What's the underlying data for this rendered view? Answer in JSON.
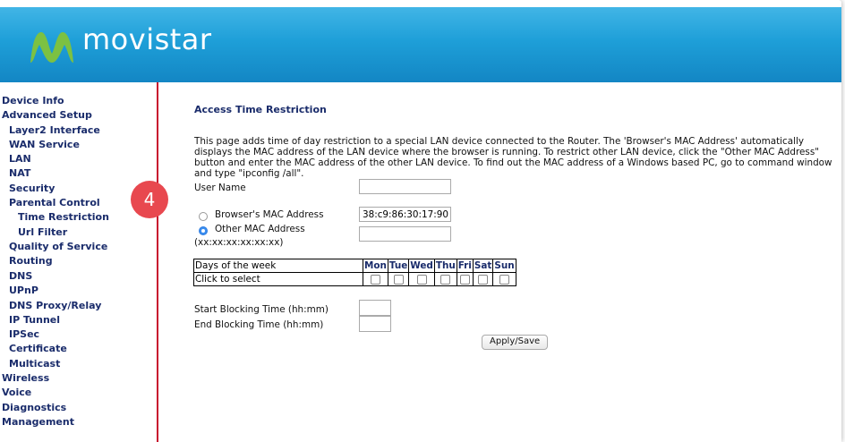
{
  "brand": {
    "name": "movistar"
  },
  "sidebar": {
    "items": [
      {
        "label": "Device Info",
        "level": 1
      },
      {
        "label": "Advanced Setup",
        "level": 1
      },
      {
        "label": "Layer2 Interface",
        "level": 2
      },
      {
        "label": "WAN Service",
        "level": 2
      },
      {
        "label": "LAN",
        "level": 2
      },
      {
        "label": "NAT",
        "level": 2
      },
      {
        "label": "Security",
        "level": 2
      },
      {
        "label": "Parental Control",
        "level": 2
      },
      {
        "label": "Time Restriction",
        "level": 3
      },
      {
        "label": "Url Filter",
        "level": 3
      },
      {
        "label": "Quality of Service",
        "level": 2
      },
      {
        "label": "Routing",
        "level": 2
      },
      {
        "label": "DNS",
        "level": 2
      },
      {
        "label": "UPnP",
        "level": 2
      },
      {
        "label": "DNS Proxy/Relay",
        "level": 2
      },
      {
        "label": "IP Tunnel",
        "level": 2
      },
      {
        "label": "IPSec",
        "level": 2
      },
      {
        "label": "Certificate",
        "level": 2
      },
      {
        "label": "Multicast",
        "level": 2
      },
      {
        "label": "Wireless",
        "level": 1
      },
      {
        "label": "Voice",
        "level": 1
      },
      {
        "label": "Diagnostics",
        "level": 1
      },
      {
        "label": "Management",
        "level": 1
      }
    ]
  },
  "badge": {
    "text": "4"
  },
  "main": {
    "title": "Access Time Restriction",
    "description": "This page adds time of day restriction to a special LAN device connected to the Router. The 'Browser's MAC Address' automatically displays the MAC address of the LAN device where the browser is running. To restrict other LAN device, click the \"Other MAC Address\" button and enter the MAC address of the other LAN device. To find out the MAC address of a Windows based PC, go to command window and type \"ipconfig /all\".",
    "user_name_label": "User Name",
    "user_name_value": "",
    "browser_mac_label": "Browser's MAC Address",
    "browser_mac_value": "38:c9:86:30:17:90",
    "browser_mac_selected": false,
    "other_mac_label": "Other MAC Address",
    "other_mac_format": "(xx:xx:xx:xx:xx:xx)",
    "other_mac_value": "",
    "other_mac_selected": true,
    "days_header_label": "Days of the week",
    "days_select_label": "Click to select",
    "days": [
      "Mon",
      "Tue",
      "Wed",
      "Thu",
      "Fri",
      "Sat",
      "Sun"
    ],
    "start_label": "Start Blocking Time (hh:mm)",
    "start_value": "",
    "end_label": "End Blocking Time (hh:mm)",
    "end_value": "",
    "apply_label": "Apply/Save"
  },
  "colors": {
    "banner": "#1e9fd8",
    "sidebar_text": "#1a2c6b",
    "divider": "#c8102e",
    "badge": "#e8484f"
  }
}
